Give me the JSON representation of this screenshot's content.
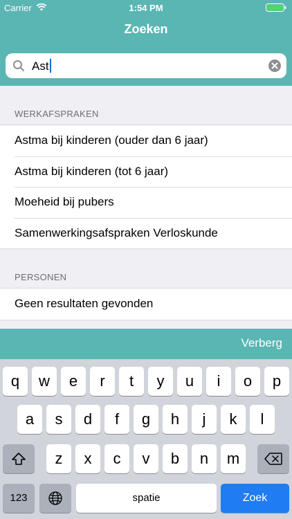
{
  "status_bar": {
    "carrier": "Carrier",
    "time": "1:54 PM"
  },
  "nav": {
    "title": "Zoeken"
  },
  "search": {
    "value": "Ast"
  },
  "sections": [
    {
      "header": "WERKAFSPRAKEN",
      "items": [
        "Astma bij kinderen (ouder dan 6 jaar)",
        "Astma bij kinderen (tot 6 jaar)",
        "Moeheid bij pubers",
        "Samenwerkingsafspraken Verloskunde"
      ]
    },
    {
      "header": "PERSONEN",
      "items": [
        "Geen resultaten gevonden"
      ]
    }
  ],
  "accessory": {
    "hide_label": "Verberg"
  },
  "keyboard": {
    "row1": [
      "q",
      "w",
      "e",
      "r",
      "t",
      "y",
      "u",
      "i",
      "o",
      "p"
    ],
    "row2": [
      "a",
      "s",
      "d",
      "f",
      "g",
      "h",
      "j",
      "k",
      "l"
    ],
    "row3": [
      "z",
      "x",
      "c",
      "v",
      "b",
      "n",
      "m"
    ],
    "numbers_label": "123",
    "space_label": "spatie",
    "go_label": "Zoek"
  },
  "colors": {
    "header": "#5ab6b3",
    "go_key": "#1f7cf2"
  }
}
